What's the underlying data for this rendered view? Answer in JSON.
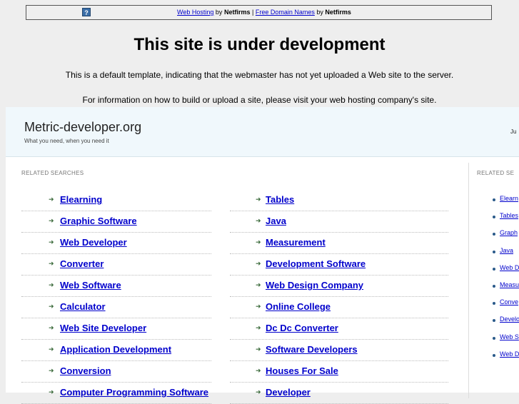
{
  "topbar": {
    "icon_glyph": "?",
    "link1": "Web Hosting",
    "by1": "by",
    "brand1": "Netfirms",
    "sep": "|",
    "link2": "Free Domain Names",
    "by2": "by",
    "brand2": "Netfirms"
  },
  "page": {
    "title": "This site is under development",
    "line1": "This is a default template, indicating that the webmaster has not yet uploaded a Web site to the server.",
    "line2": "For information on how to build or upload a site, please visit your web hosting company's site."
  },
  "parked": {
    "site_name": "Metric-developer.org",
    "tagline": "What you need, when you need it",
    "date_fragment": "Ju",
    "section_label": "RELATED SEARCHES",
    "side_label": "RELATED SE",
    "left_links": [
      "Elearning",
      "Graphic Software",
      "Web Developer",
      "Converter",
      "Web Software",
      "Calculator",
      "Web Site Developer",
      "Application Development",
      "Conversion",
      "Computer Programming Software"
    ],
    "right_links": [
      "Tables",
      "Java",
      "Measurement",
      "Development Software",
      "Web Design Company",
      "Online College",
      "Dc Dc Converter",
      "Software Developers",
      "Houses For Sale",
      "Developer"
    ],
    "side_links": [
      "Elearn",
      "Tables",
      "Graph",
      "Java",
      "Web D",
      "Measu",
      "Conve",
      "Develo",
      "Web S",
      "Web D"
    ]
  },
  "colors": {
    "link": "#0000cc",
    "header_bg": "#f0f8fc",
    "page_bg": "#eeeeee"
  }
}
